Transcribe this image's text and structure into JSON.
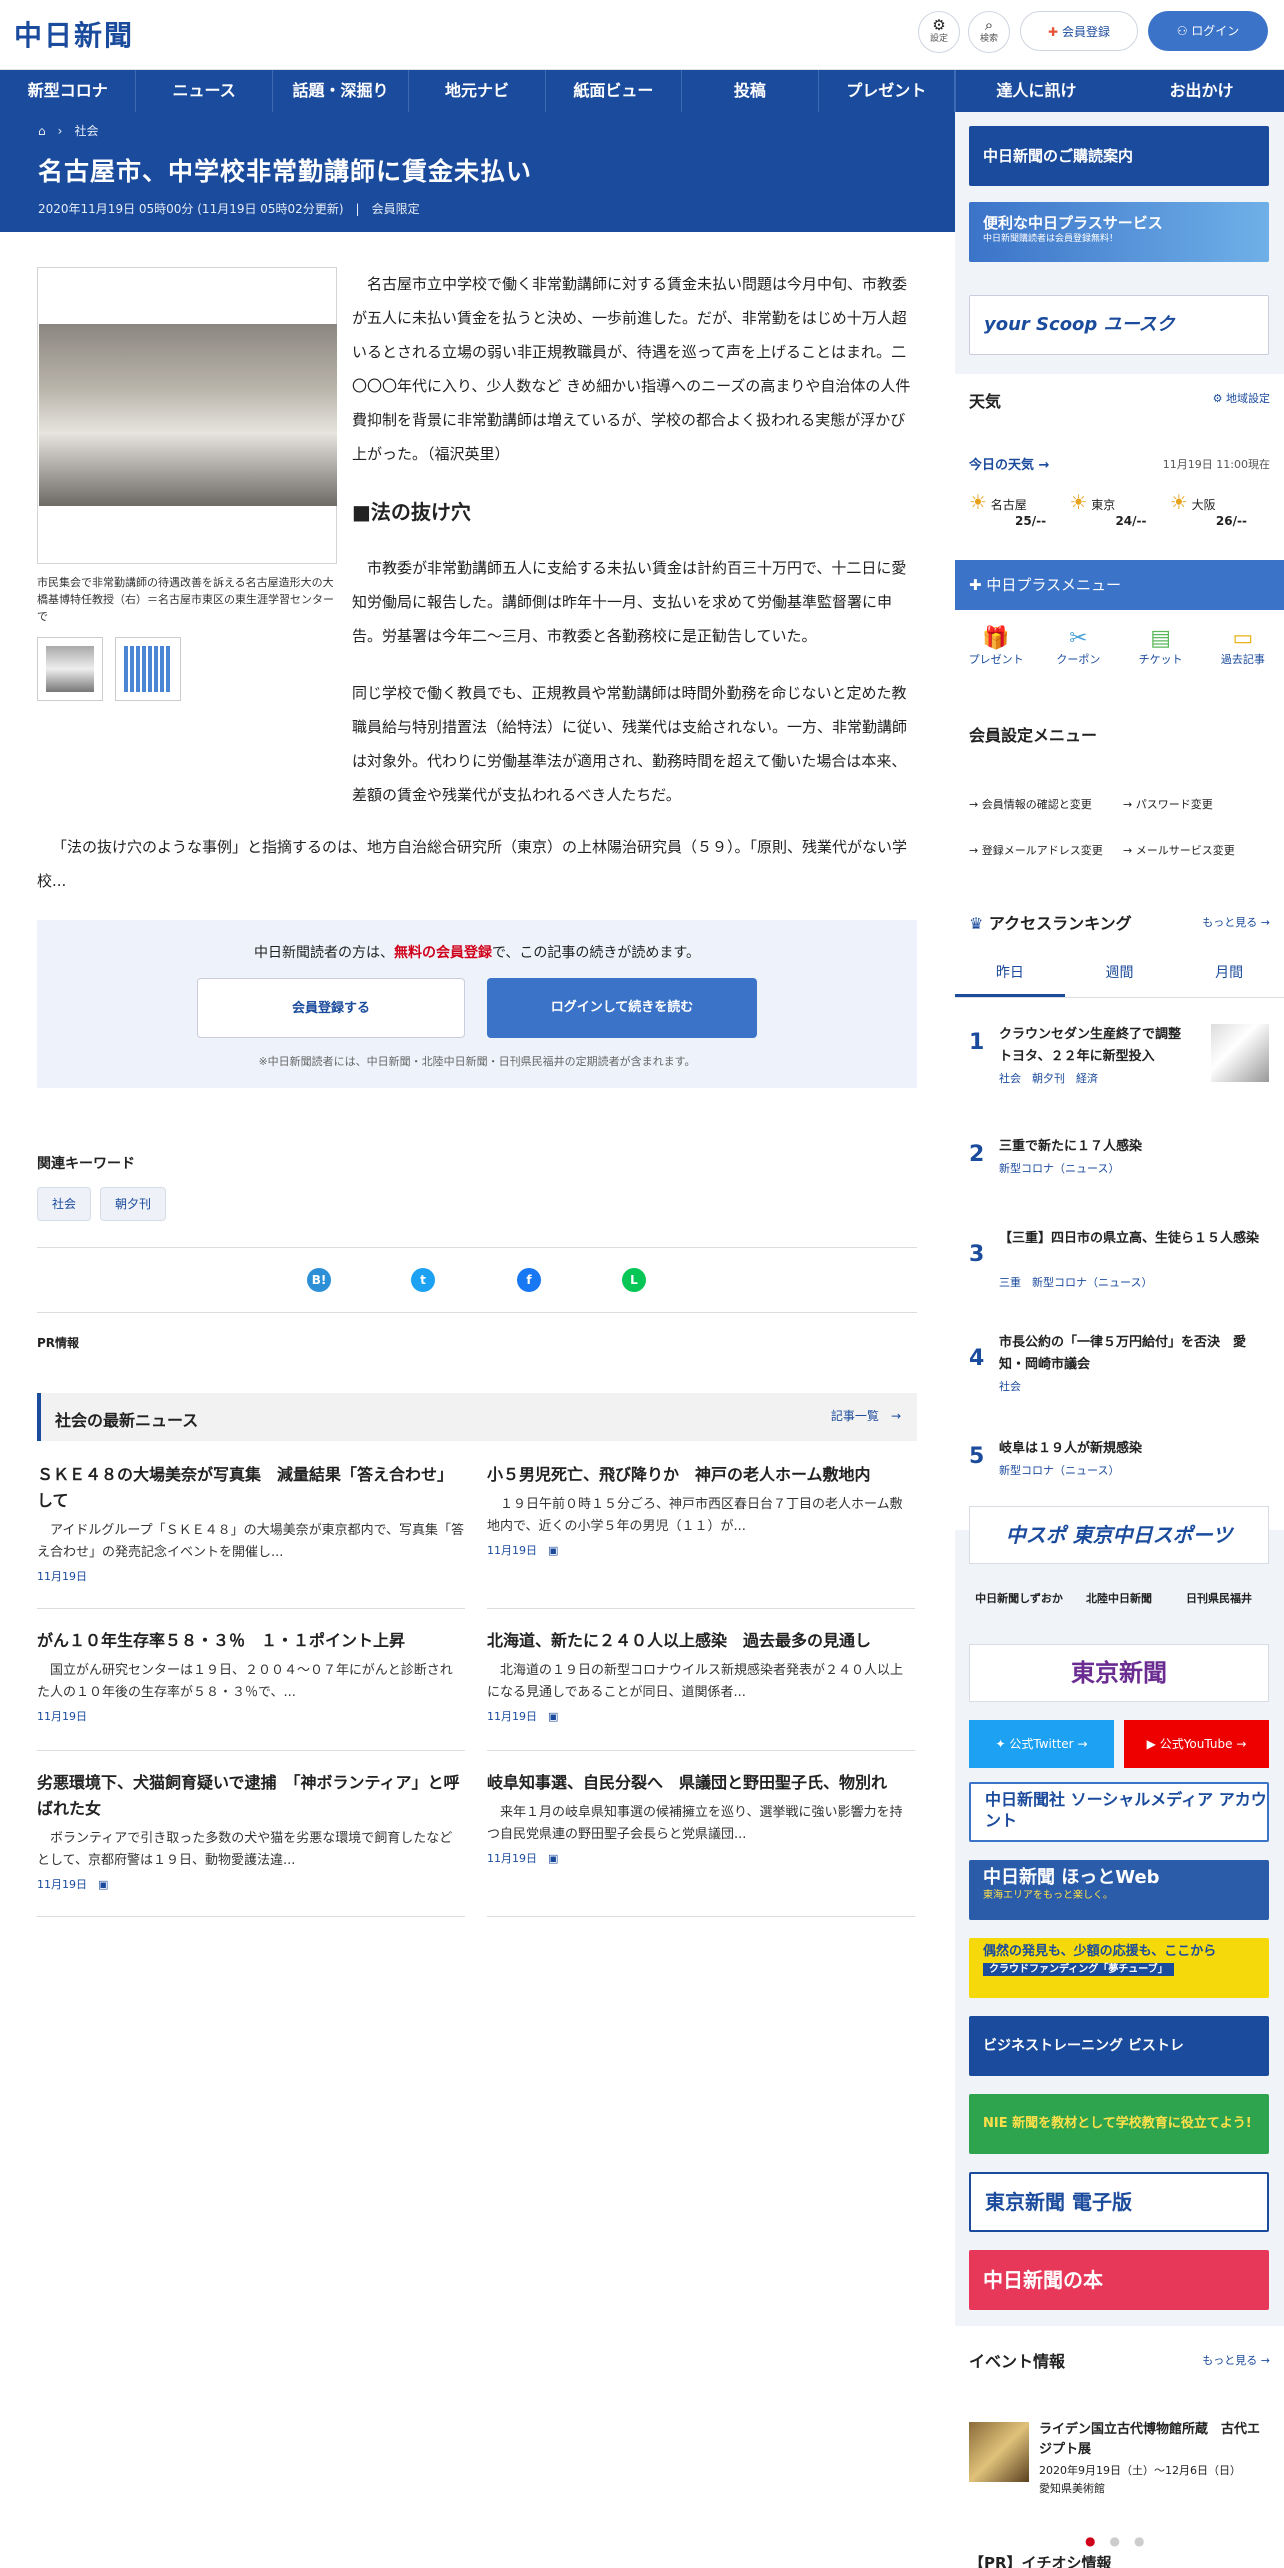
{
  "header": {
    "logo": "中日新聞",
    "settings_label": "設定",
    "search_label": "検索",
    "register_label": "会員登録",
    "login_label": "ログイン"
  },
  "nav": [
    "新型コロナ",
    "ニュース",
    "話題・深掘り",
    "地元ナビ",
    "紙面ビュー",
    "投稿",
    "プレゼント",
    "達人に訊け",
    "お出かけ"
  ],
  "breadcrumb": {
    "section": "社会"
  },
  "article": {
    "title": "名古屋市、中学校非常勤講師に賃金未払い",
    "dateline": "2020年11月19日 05時00分 (11月19日 05時02分更新)",
    "member_only": "会員限定",
    "caption": "市民集会で非常勤講師の待遇改善を訴える名古屋造形大の大橋基博特任教授（右）＝名古屋市東区の東生涯学習センターで",
    "p1": "名古屋市立中学校で働く非常勤講師に対する賃金未払い問題は今月中旬、市教委が五人に未払い賃金を払うと決め、一歩前進した。だが、非常勤をはじめ十万人超いるとされる立場の弱い非正規教職員が、待遇を巡って声を上げることはまれ。二〇〇〇年代に入り、少人数など きめ細かい指導へのニーズの高まりや自治体の人件費抑制を背景に非常勤講師は増えているが、学校の都合よく扱われる実態が浮かび上がった。（福沢英里）",
    "h2": "■法の抜け穴",
    "p2": "市教委が非常勤講師五人に支給する未払い賃金は計約百三十万円で、十二日に愛知労働局に報告した。講師側は昨年十一月、支払いを求めて労働基準監督署に申告。労基署は今年二〜三月、市教委と各勤務校に是正勧告していた。",
    "p3": "同じ学校で働く教員でも、正規教員や常勤講師は時間外勤務を命じないと定めた教職員給与特別措置法（給特法）に従い、残業代は支給されない。一方、非常勤講師は対象外。代わりに労働基準法が適用され、勤務時間を超えて働いた場合は本来、差額の賃金や残業代が支払われるべき人たちだ。",
    "p4": "「法の抜け穴のような事例」と指摘するのは、地方自治総合研究所（東京）の上林陽治研究員（５９）。「原則、残業代がない学校..."
  },
  "paywall": {
    "msg_pre": "中日新聞読者の方は、",
    "msg_link": "無料の会員登録",
    "msg_post": "で、この記事の続きが読めます。",
    "register": "会員登録する",
    "login": "ログインして続きを読む",
    "note": "※中日新聞読者には、中日新聞・北陸中日新聞・日刊県民福井の定期読者が含まれます。"
  },
  "keywords": {
    "heading": "関連キーワード",
    "tags": [
      "社会",
      "朝夕刊"
    ]
  },
  "pr_label": "PR情報",
  "latest": {
    "heading": "社会の最新ニュース",
    "list_link": "記事一覧",
    "items": [
      {
        "title": "ＳＫＥ４８の大場美奈が写真集　減量結果「答え合わせ」して",
        "desc": "アイドルグループ「ＳＫＥ４８」の大場美奈が東京都内で、写真集「答え合わせ」の発売記念イベントを開催し...",
        "date": "11月19日"
      },
      {
        "title": "小５男児死亡、飛び降りか　神戸の老人ホーム敷地内",
        "desc": "１９日午前０時１５分ごろ、神戸市西区春日台７丁目の老人ホーム敷地内で、近くの小学５年の男児（１１）が...",
        "date": "11月19日"
      },
      {
        "title": "がん１０年生存率５８・３％　１・１ポイント上昇",
        "desc": "国立がん研究センターは１９日、２００４〜０７年にがんと診断された人の１０年後の生存率が５８・３％で、...",
        "date": "11月19日"
      },
      {
        "title": "北海道、新たに２４０人以上感染　過去最多の見通し",
        "desc": "北海道の１９日の新型コロナウイルス新規感染者発表が２４０人以上になる見通しであることが同日、道関係者...",
        "date": "11月19日"
      },
      {
        "title": "劣悪環境下、犬猫飼育疑いで逮捕　「神ボランティア」と呼ばれた女",
        "desc": "ボランティアで引き取った多数の犬や猫を劣悪な環境で飼育したなどとして、京都府警は１９日、動物愛護法違...",
        "date": "11月19日"
      },
      {
        "title": "岐阜知事選、自民分裂へ　県議団と野田聖子氏、物別れ",
        "desc": "来年１月の岐阜県知事選の候補擁立を巡り、選挙戦に強い影響力を持つ自民党県連の野田聖子会長らと党県議団...",
        "date": "11月19日"
      }
    ]
  },
  "sidebar": {
    "banner1": "中日新聞のご購読案内",
    "banner2": "便利な中日プラスサービス",
    "banner2_sub": "中日新聞購読者は会員登録無料！",
    "banner3": "your Scoop ユースク",
    "weather": {
      "heading": "天気",
      "region_setting": "地域設定",
      "today": "今日の天気",
      "time": "11月19日 11:00現在",
      "cities": [
        {
          "name": "名古屋",
          "temp": "25/--"
        },
        {
          "name": "東京",
          "temp": "24/--"
        },
        {
          "name": "大阪",
          "temp": "26/--"
        }
      ]
    },
    "plus_menu": {
      "heading": "中日プラスメニュー",
      "items": [
        "プレゼント",
        "クーポン",
        "チケット",
        "過去記事"
      ]
    },
    "member_menu": {
      "heading": "会員設定メニュー",
      "items": [
        "会員情報の確認と変更",
        "パスワード変更",
        "登録メールアドレス変更",
        "メールサービス変更"
      ]
    },
    "ranking": {
      "heading": "アクセスランキング",
      "more": "もっと見る",
      "tabs": [
        "昨日",
        "週間",
        "月間"
      ],
      "items": [
        {
          "num": "1",
          "title": "クラウンセダン生産終了で調整　トヨタ、２２年に新型投入",
          "tags": "社会　朝夕刊　経済"
        },
        {
          "num": "2",
          "title": "三重で新たに１７人感染",
          "tags": "新型コロナ（ニュース）"
        },
        {
          "num": "3",
          "title": "【三重】四日市の県立高、生徒ら１５人感染",
          "tags": "三重　新型コロナ（ニュース）"
        },
        {
          "num": "4",
          "title": "市長公約の「一律５万円給付」を否決　愛知・岡崎市議会",
          "tags": "社会"
        },
        {
          "num": "5",
          "title": "岐阜は１９人が新規感染",
          "tags": "新型コロナ（ニュース）"
        }
      ]
    },
    "sponsor1": "中スポ 東京中日スポーツ",
    "partners": [
      "中日新聞しずおか",
      "北陸中日新聞",
      "日刊県民福井"
    ],
    "tokyo": "東京新聞",
    "twitter": "公式Twitter",
    "youtube": "公式YouTube",
    "social_banner": "中日新聞社 ソーシャルメディア アカウント",
    "hotweb": "中日新聞 ほっとWeb",
    "hotweb_sub": "東海エリアをもっと楽しく。",
    "crowd": "偶然の発見も、少額の応援も、ここから",
    "crowd_sub": "クラウドファンディング「夢チューブ」",
    "bistore": "ビジネストレーニング ビストレ",
    "nie": "NIE 新聞を教材として学校教育に役立てよう!",
    "tokyo_e": "東京新聞 電子版",
    "books": "中日新聞の本",
    "events": {
      "heading": "イベント情報",
      "more": "もっと見る",
      "title": "ライデン国立古代博物館所蔵　古代エジプト展",
      "date": "2020年9月19日（土）〜12月6日（日）",
      "venue": "愛知県美術館"
    },
    "pr_recommend": "【PR】イチオシ情報"
  }
}
